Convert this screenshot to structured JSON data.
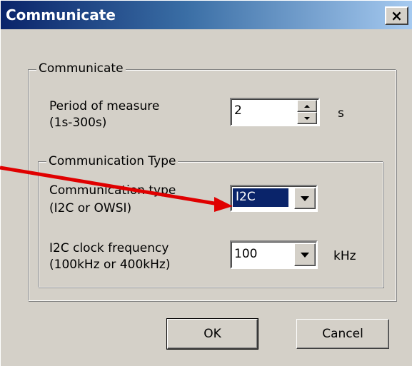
{
  "window": {
    "title": "Communicate",
    "close_glyph": "×"
  },
  "group_communicate": {
    "legend": "Communicate",
    "period": {
      "label_line1": "Period of measure",
      "label_line2": "(1s-300s)",
      "value": "2",
      "unit": "s"
    }
  },
  "group_comm_type": {
    "legend": "Communication Type",
    "type": {
      "label_line1": "Communication type",
      "label_line2": "(I2C or OWSI)",
      "selected": "I2C"
    },
    "clock": {
      "label_line1": "I2C clock frequency",
      "label_line2": "(100kHz or 400kHz)",
      "selected": "100",
      "unit": "kHz"
    }
  },
  "buttons": {
    "ok": "OK",
    "cancel": "Cancel"
  },
  "colors": {
    "title_bar": "#0a246a",
    "selection": "#0a246a",
    "annotation_arrow": "#e00000",
    "dialog_face": "#d4d0c8"
  },
  "icons": {
    "close": "close-icon",
    "dropdown": "chevron-down-icon",
    "spin_up": "spin-up-icon",
    "spin_down": "spin-down-icon"
  }
}
